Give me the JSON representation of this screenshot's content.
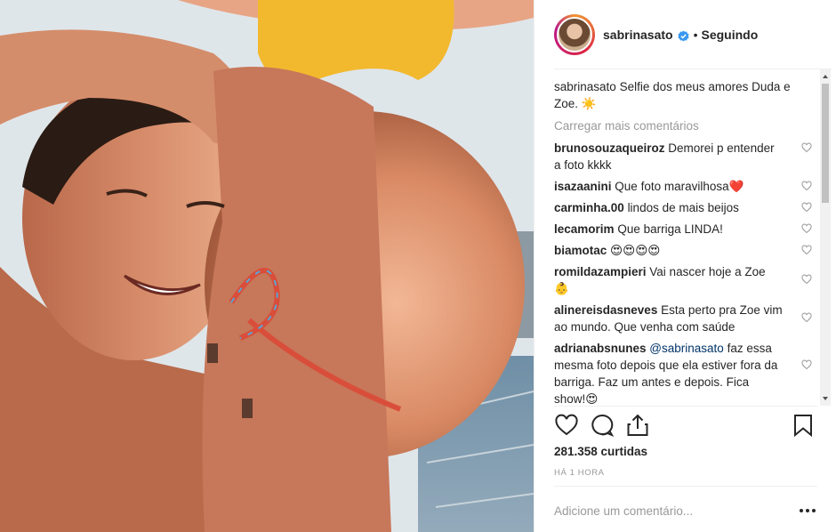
{
  "post": {
    "username": "sabrinasato",
    "follow_status": "Seguindo",
    "separator": "•",
    "caption_text": "Selfie dos meus amores Duda e Zoe. ☀️",
    "load_more": "Carregar mais comentários",
    "likes": "281.358 curtidas",
    "time_ago": "HÁ 1 HORA"
  },
  "comments": [
    {
      "user": "brunosouzaqueiroz",
      "text": "Demorei p entender a foto kkkk"
    },
    {
      "user": "isazaanini",
      "text": "Que foto maravilhosa❤️"
    },
    {
      "user": "carminha.00",
      "text": "lindos de mais beijos"
    },
    {
      "user": "lecamorim",
      "text": "Que barriga LINDA!"
    },
    {
      "user": "biamotac",
      "text": "😍😍😍😍"
    },
    {
      "user": "romildazampieri",
      "text": "Vai nascer hoje a Zoe 👶"
    },
    {
      "user": "alinereisdasneves",
      "text": "Esta perto pra Zoe vim ao mundo. Que venha com saúde"
    },
    {
      "user": "adrianabsnunes",
      "mention": "@sabrinasato",
      "text": "faz essa mesma foto depois que ela estiver fora da barriga. Faz um antes e depois. Fica show!😍"
    }
  ],
  "comment_box": {
    "placeholder": "Adicione um comentário..."
  },
  "icons": {
    "verified": "verified-badge-icon",
    "like": "heart-icon",
    "comment": "comment-bubble-icon",
    "share": "share-icon",
    "save": "bookmark-icon",
    "more": "more-dots-icon"
  },
  "colors": {
    "verified_blue": "#3897f0",
    "text": "#262626",
    "muted": "#999999",
    "mention": "#003569",
    "heart_red": "#c0142a"
  }
}
